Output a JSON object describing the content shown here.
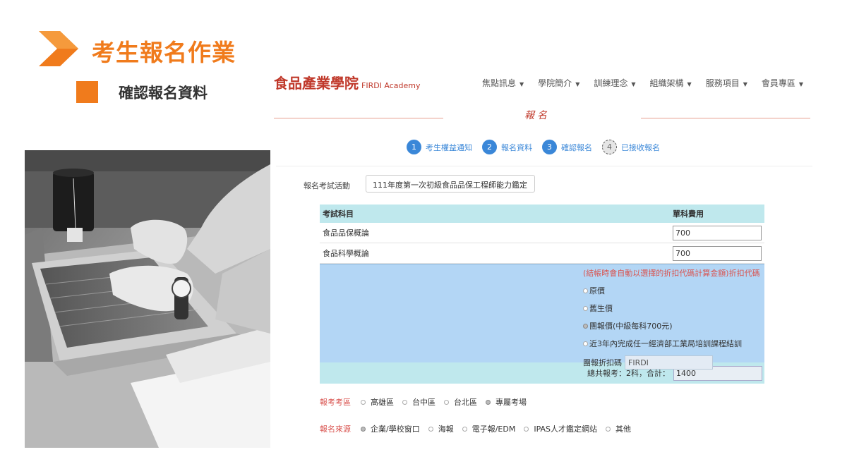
{
  "slide": {
    "title": "考生報名作業",
    "subtitle": "確認報名資料",
    "accent_color": "#f07b1c"
  },
  "site": {
    "logo_cn": "食品產業學院",
    "logo_en": "FIRDI Academy",
    "nav": [
      {
        "label": "焦點訊息"
      },
      {
        "label": "學院簡介"
      },
      {
        "label": "訓練理念"
      },
      {
        "label": "組織架構"
      },
      {
        "label": "服務項目"
      },
      {
        "label": "會員專區"
      }
    ],
    "section_title": "報名",
    "steps": [
      {
        "num": "1",
        "label": "考生權益通知"
      },
      {
        "num": "2",
        "label": "報名資料"
      },
      {
        "num": "3",
        "label": "確認報名"
      },
      {
        "num": "4",
        "label": "已接收報名"
      }
    ],
    "activity": {
      "label": "報名考試活動",
      "value": "111年度第一次初級食品品保工程師能力鑑定"
    },
    "fees": {
      "col_subject": "考試科目",
      "col_fee": "單科費用",
      "rows": [
        {
          "subject": "食品品保概論",
          "fee": "700"
        },
        {
          "subject": "食品科學概論",
          "fee": "700"
        }
      ]
    },
    "discount": {
      "note": "(結帳時會自動以選擇的折扣代碼計算金額)折扣代碼",
      "options": [
        {
          "label": "原價",
          "checked": false
        },
        {
          "label": "舊生價",
          "checked": false
        },
        {
          "label": "團報價(中級每科700元)",
          "checked": true
        },
        {
          "label": "近3年內完成任一經濟部工業局培訓課程結訓",
          "checked": false
        }
      ],
      "code_label": "團報折扣碼",
      "code_value": "FIRDI"
    },
    "total": {
      "label": "總共報考：2科，合計：",
      "value": "1400"
    },
    "region": {
      "label": "報考考區",
      "options": [
        {
          "label": "高雄區",
          "checked": false
        },
        {
          "label": "台中區",
          "checked": false
        },
        {
          "label": "台北區",
          "checked": false
        },
        {
          "label": "專屬考場",
          "checked": true
        }
      ]
    },
    "source": {
      "label": "報名來源",
      "options": [
        {
          "label": "企業/學校窗口",
          "checked": true
        },
        {
          "label": "海報",
          "checked": false
        },
        {
          "label": "電子報/EDM",
          "checked": false
        },
        {
          "label": "IPAS人才鑑定網站",
          "checked": false
        },
        {
          "label": "其他",
          "checked": false
        }
      ]
    }
  }
}
